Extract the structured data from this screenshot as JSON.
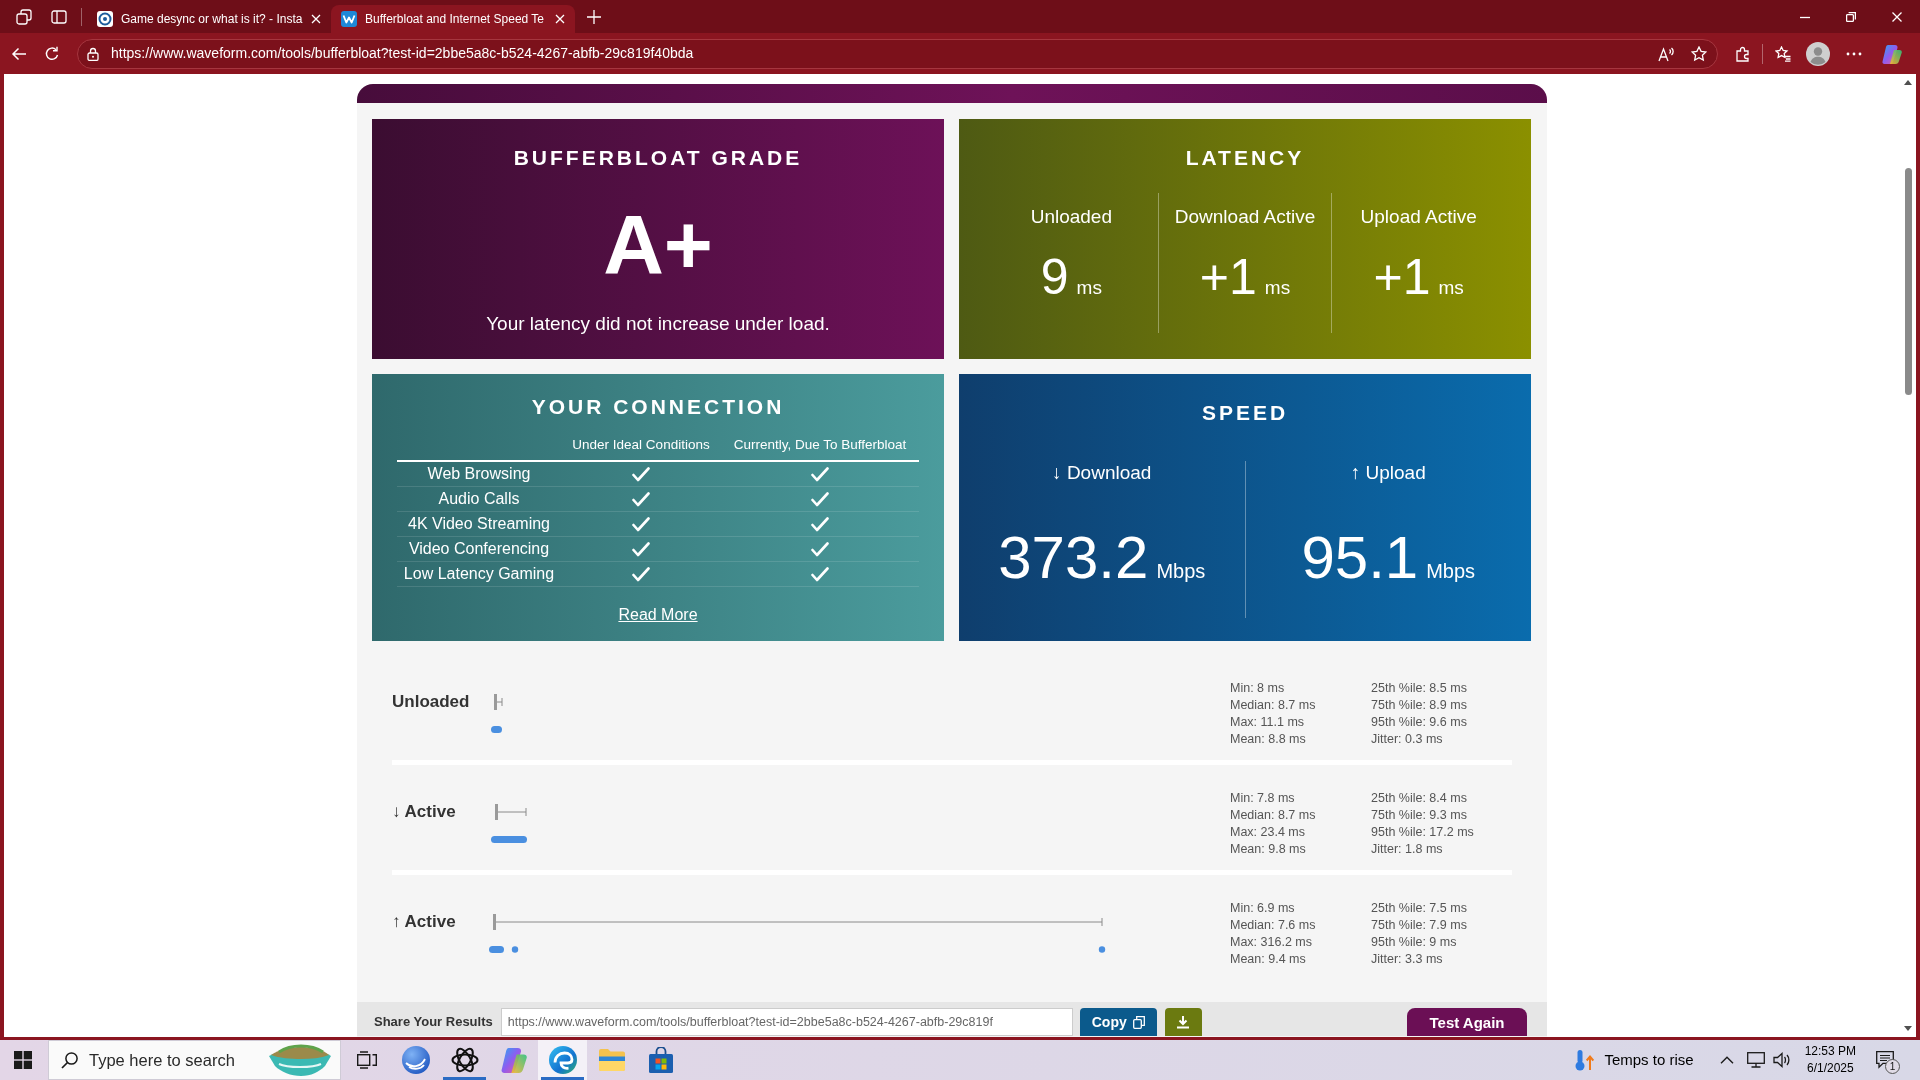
{
  "browser": {
    "tabs": [
      {
        "title": "Game desync or what is it? - Insta",
        "selected": false
      },
      {
        "title": "Bufferbloat and Internet Speed Te",
        "selected": true
      }
    ],
    "address": "https://www.waveform.com/tools/bufferbloat?test-id=2bbe5a8c-b524-4267-abfb-29c819f40bda"
  },
  "grade": {
    "title": "BUFFERBLOAT GRADE",
    "grade": "A+",
    "message": "Your latency did not increase under load."
  },
  "latency": {
    "title": "LATENCY",
    "columns": [
      {
        "label": "Unloaded",
        "value": "9",
        "unit": "ms"
      },
      {
        "label": "Download Active",
        "value": "+1",
        "unit": "ms"
      },
      {
        "label": "Upload Active",
        "value": "+1",
        "unit": "ms"
      }
    ]
  },
  "connection": {
    "title": "YOUR CONNECTION",
    "headers": [
      "Under Ideal Conditions",
      "Currently, Due To Bufferbloat"
    ],
    "rows": [
      {
        "name": "Web Browsing",
        "ideal": true,
        "current": true
      },
      {
        "name": "Audio Calls",
        "ideal": true,
        "current": true
      },
      {
        "name": "4K Video Streaming",
        "ideal": true,
        "current": true
      },
      {
        "name": "Video Conferencing",
        "ideal": true,
        "current": true
      },
      {
        "name": "Low Latency Gaming",
        "ideal": true,
        "current": true
      }
    ],
    "link": "Read More"
  },
  "speed": {
    "title": "SPEED",
    "columns": [
      {
        "label": "↓ Download",
        "value": "373.2",
        "unit": "Mbps"
      },
      {
        "label": "↑ Upload",
        "value": "95.1",
        "unit": "Mbps"
      }
    ]
  },
  "results": [
    {
      "label": "Unloaded",
      "stats_left": [
        "Min: 8 ms",
        "Median: 8.7 ms",
        "Max: 11.1 ms",
        "Mean: 8.8 ms"
      ],
      "stats_right": [
        "25th %ile: 8.5 ms",
        "75th %ile: 8.9 ms",
        "95th %ile: 9.6 ms",
        "Jitter: 0.3 ms"
      ]
    },
    {
      "label": "↓ Active",
      "stats_left": [
        "Min: 7.8 ms",
        "Median: 8.7 ms",
        "Max: 23.4 ms",
        "Mean: 9.8 ms"
      ],
      "stats_right": [
        "25th %ile: 8.4 ms",
        "75th %ile: 9.3 ms",
        "95th %ile: 17.2 ms",
        "Jitter: 1.8 ms"
      ]
    },
    {
      "label": "↑ Active",
      "stats_left": [
        "Min: 6.9 ms",
        "Median: 7.6 ms",
        "Max: 316.2 ms",
        "Mean: 9.4 ms"
      ],
      "stats_right": [
        "25th %ile: 7.5 ms",
        "75th %ile: 7.9 ms",
        "95th %ile: 9 ms",
        "Jitter: 3.3 ms"
      ]
    }
  ],
  "share": {
    "label": "Share Your Results",
    "url": "https://www.waveform.com/tools/bufferbloat?test-id=2bbe5a8c-b524-4267-abfb-29c819f",
    "copy": "Copy",
    "test_again": "Test Again"
  },
  "taskbar": {
    "search_placeholder": "Type here to search",
    "apps": [
      {
        "kind": "task-view",
        "selected": false,
        "running": false
      },
      {
        "kind": "sphere",
        "selected": false,
        "running": false
      },
      {
        "kind": "knot",
        "selected": false,
        "running": true
      },
      {
        "kind": "swirl",
        "selected": false,
        "running": false
      },
      {
        "kind": "wave",
        "selected": true,
        "running": true
      },
      {
        "kind": "folder",
        "selected": false,
        "running": false
      },
      {
        "kind": "store",
        "selected": false,
        "running": false
      }
    ],
    "weather": "Temps to rise",
    "time": "12:53 PM",
    "date": "6/1/2025",
    "notification_count": "1"
  }
}
